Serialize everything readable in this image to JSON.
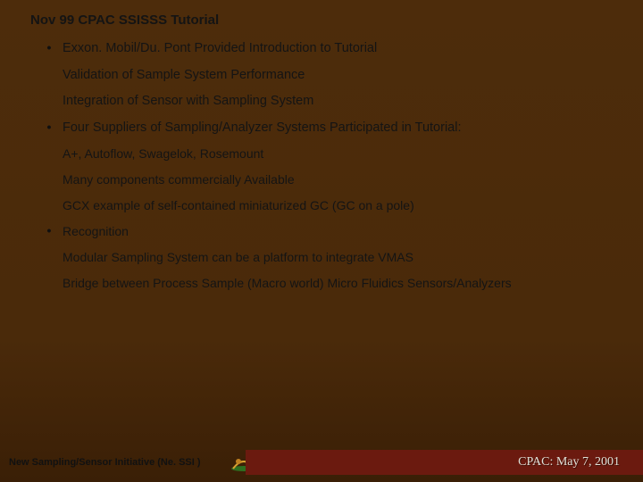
{
  "title": "Nov 99 CPAC SSISSS Tutorial",
  "items": {
    "b1_head": "Exxon. Mobil/Du. Pont Provided Introduction to Tutorial",
    "b1_sub1": "Validation of Sample System Performance",
    "b1_sub2": "Integration of Sensor with Sampling System",
    "b2_head": "Four Suppliers of Sampling/Analyzer Systems Participated in Tutorial:",
    "b2_sub1": "A+, Autoflow, Swagelok, Rosemount",
    "b2_sub2": "Many components commercially Available",
    "b2_sub3": "GCX example of self-contained miniaturized GC (GC on a pole)",
    "b3_head": "Recognition",
    "b3_sub1": "Modular Sampling System can be a platform to integrate VMAS",
    "b3_sub2": "Bridge between Process Sample (Macro world) Micro Fluidics Sensors/Analyzers"
  },
  "footer": {
    "left": "New Sampling/Sensor Initiative (Ne. SSI )",
    "right": "CPAC: May 7,  2001",
    "icon_name": "logo-icon"
  },
  "bullet_glyph": "•"
}
